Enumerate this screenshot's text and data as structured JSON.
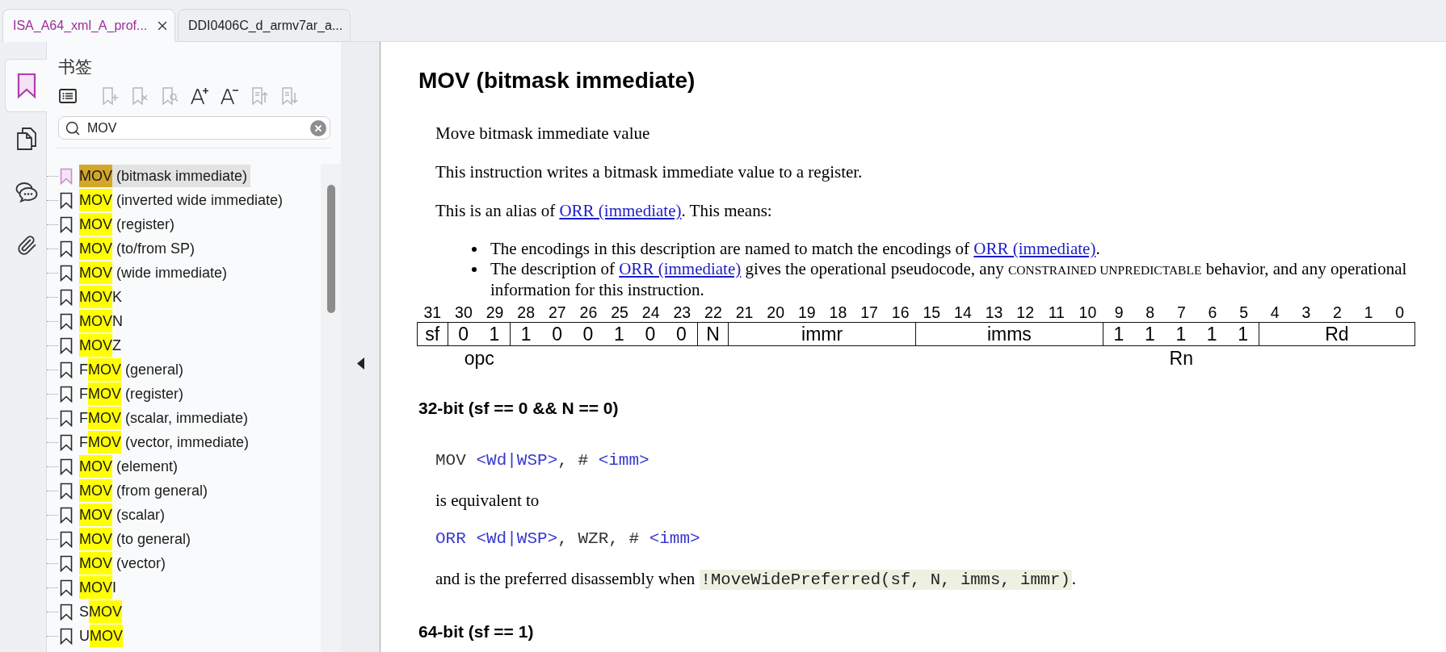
{
  "tabs": [
    {
      "label": "ISA_A64_xml_A_prof...",
      "selected": true
    },
    {
      "label": "DDI0406C_d_armv7ar_a...",
      "selected": false
    }
  ],
  "rail": [
    {
      "kind": "bookmarks",
      "selected": true
    },
    {
      "kind": "pages",
      "selected": false
    },
    {
      "kind": "comments",
      "selected": false
    },
    {
      "kind": "attachments",
      "selected": false
    }
  ],
  "sidebar": {
    "title": "书签",
    "toolbar": [
      {
        "kind": "outline",
        "disabled": false
      },
      {
        "kind": "add",
        "disabled": true
      },
      {
        "kind": "delete",
        "disabled": true
      },
      {
        "kind": "find",
        "disabled": true
      },
      {
        "kind": "enlarge-text",
        "disabled": false
      },
      {
        "kind": "shrink-text",
        "disabled": false
      },
      {
        "kind": "move-up",
        "disabled": true
      },
      {
        "kind": "move-down",
        "disabled": true
      }
    ],
    "search": {
      "value": "MOV"
    },
    "items": [
      {
        "match": "MOV",
        "after": " (bitmask immediate)",
        "selected": true
      },
      {
        "match": "MOV",
        "after": " (inverted wide immediate)",
        "selected": false
      },
      {
        "match": "MOV",
        "after": " (register)",
        "selected": false
      },
      {
        "match": "MOV",
        "after": " (to/from SP)",
        "selected": false
      },
      {
        "match": "MOV",
        "after": " (wide immediate)",
        "selected": false
      },
      {
        "match": "MOV",
        "after": "K",
        "selected": false
      },
      {
        "match": "MOV",
        "after": "N",
        "selected": false
      },
      {
        "match": "MOV",
        "after": "Z",
        "selected": false
      },
      {
        "before": "F",
        "match": "MOV",
        "after": " (general)",
        "selected": false
      },
      {
        "before": "F",
        "match": "MOV",
        "after": " (register)",
        "selected": false
      },
      {
        "before": "F",
        "match": "MOV",
        "after": " (scalar, immediate)",
        "selected": false
      },
      {
        "before": "F",
        "match": "MOV",
        "after": " (vector, immediate)",
        "selected": false
      },
      {
        "match": "MOV",
        "after": " (element)",
        "selected": false
      },
      {
        "match": "MOV",
        "after": " (from general)",
        "selected": false
      },
      {
        "match": "MOV",
        "after": " (scalar)",
        "selected": false
      },
      {
        "match": "MOV",
        "after": " (to general)",
        "selected": false
      },
      {
        "match": "MOV",
        "after": " (vector)",
        "selected": false
      },
      {
        "match": "MOV",
        "after": "I",
        "selected": false
      },
      {
        "before": "S",
        "match": "MOV",
        "selected": false
      },
      {
        "before": "U",
        "match": "MOV",
        "selected": false
      }
    ]
  },
  "document": {
    "blocks": [
      {
        "kind": "heading",
        "text": "MOV (bitmask immediate)"
      },
      {
        "kind": "paragraph",
        "parts": [
          {
            "kind": "text",
            "text": "Move bitmask immediate value"
          }
        ]
      },
      {
        "kind": "paragraph",
        "parts": [
          {
            "kind": "text",
            "text": "This instruction writes a bitmask immediate value to a register."
          }
        ]
      },
      {
        "kind": "paragraph",
        "parts": [
          {
            "kind": "text",
            "text": "This is an alias of "
          },
          {
            "kind": "link",
            "text": "ORR (immediate)"
          },
          {
            "kind": "text",
            "text": ". This means:"
          }
        ]
      },
      {
        "kind": "bullets",
        "items": [
          {
            "parts": [
              {
                "kind": "text",
                "text": "The encodings in this description are named to match the encodings of "
              },
              {
                "kind": "link",
                "text": "ORR (immediate)"
              },
              {
                "kind": "text",
                "text": "."
              }
            ]
          },
          {
            "parts": [
              {
                "kind": "text",
                "text": "The description of "
              },
              {
                "kind": "link",
                "text": "ORR (immediate)"
              },
              {
                "kind": "text",
                "text": " gives the operational pseudocode, any "
              },
              {
                "kind": "smallcaps",
                "text": "CONSTRAINED UNPREDICTABLE"
              },
              {
                "kind": "text",
                "text": " behavior, and any operational information for this instruction."
              }
            ]
          }
        ]
      },
      {
        "kind": "encoding",
        "fields": [
          {
            "bit_numbers": [
              "31"
            ],
            "label": "sf"
          },
          {
            "bit_numbers": [
              "30",
              "29"
            ],
            "values": [
              "0",
              "1"
            ],
            "caption": "opc"
          },
          {
            "bit_numbers": [
              "28",
              "27",
              "26",
              "25",
              "24",
              "23"
            ],
            "values": [
              "1",
              "0",
              "0",
              "1",
              "0",
              "0"
            ]
          },
          {
            "bit_numbers": [
              "22"
            ],
            "label": "N"
          },
          {
            "bit_numbers": [
              "21",
              "20",
              "19",
              "18",
              "17",
              "16"
            ],
            "label": "immr"
          },
          {
            "bit_numbers": [
              "15",
              "14",
              "13",
              "12",
              "11",
              "10"
            ],
            "label": "imms"
          },
          {
            "bit_numbers": [
              "9",
              "8",
              "7",
              "6",
              "5"
            ],
            "values": [
              "1",
              "1",
              "1",
              "1",
              "1"
            ],
            "caption": "Rn"
          },
          {
            "bit_numbers": [
              "4",
              "3",
              "2",
              "1",
              "0"
            ],
            "label": "Rd"
          }
        ]
      },
      {
        "kind": "subheading",
        "text": "32-bit (sf == 0 && N == 0)"
      },
      {
        "kind": "code",
        "parts": [
          {
            "kind": "text",
            "text": "MOV "
          },
          {
            "kind": "link",
            "text": "<Wd|WSP>"
          },
          {
            "kind": "text",
            "text": ", #"
          },
          {
            "kind": "link",
            "text": "<imm>"
          }
        ]
      },
      {
        "kind": "paragraph",
        "parts": [
          {
            "kind": "text",
            "text": "is equivalent to"
          }
        ]
      },
      {
        "kind": "code",
        "parts": [
          {
            "kind": "link",
            "text": "ORR"
          },
          {
            "kind": "link",
            "text": "<Wd|WSP>"
          },
          {
            "kind": "text",
            "text": ", WZR, #"
          },
          {
            "kind": "link",
            "text": "<imm>"
          }
        ]
      },
      {
        "kind": "paragraph",
        "parts": [
          {
            "kind": "text",
            "text": "and is the preferred disassembly when "
          },
          {
            "kind": "code",
            "text": "!MoveWidePreferred(sf, N, imms, immr)"
          },
          {
            "kind": "text",
            "text": "."
          }
        ]
      },
      {
        "kind": "subheading",
        "text": "64-bit (sf == 1)"
      }
    ]
  }
}
